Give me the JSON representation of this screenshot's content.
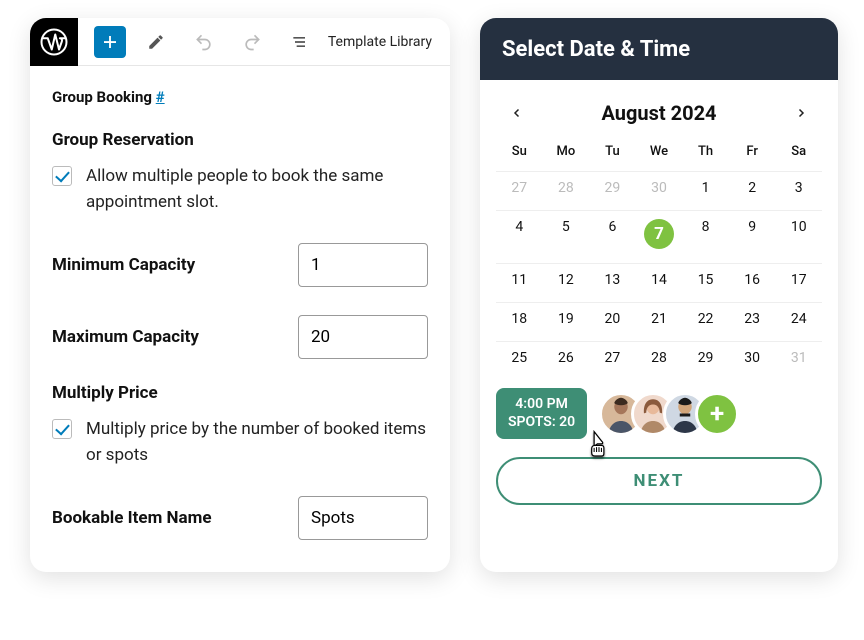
{
  "editor": {
    "toolbar": {
      "template_library": "Template Library"
    },
    "block_title": "Group Booking",
    "block_hash": "#",
    "group_reservation": {
      "title": "Group Reservation",
      "desc": "Allow multiple people to book the same appointment slot.",
      "checked": true
    },
    "min_capacity": {
      "label": "Minimum Capacity",
      "value": "1"
    },
    "max_capacity": {
      "label": "Maximum Capacity",
      "value": "20"
    },
    "multiply_price": {
      "title": "Multiply Price",
      "desc": "Multiply price by the number of booked items or spots",
      "checked": true
    },
    "bookable_item": {
      "label": "Bookable Item Name",
      "value": "Spots"
    }
  },
  "booking": {
    "header": "Select Date & Time",
    "month": "August 2024",
    "weekdays": [
      "Su",
      "Mo",
      "Tu",
      "We",
      "Th",
      "Fr",
      "Sa"
    ],
    "days": [
      {
        "d": "27",
        "other": true
      },
      {
        "d": "28",
        "other": true
      },
      {
        "d": "29",
        "other": true
      },
      {
        "d": "30",
        "other": true
      },
      {
        "d": "1"
      },
      {
        "d": "2"
      },
      {
        "d": "3"
      },
      {
        "d": "4"
      },
      {
        "d": "5"
      },
      {
        "d": "6"
      },
      {
        "d": "7",
        "selected": true
      },
      {
        "d": "8"
      },
      {
        "d": "9"
      },
      {
        "d": "10"
      },
      {
        "d": "11"
      },
      {
        "d": "12"
      },
      {
        "d": "13"
      },
      {
        "d": "14"
      },
      {
        "d": "15"
      },
      {
        "d": "16"
      },
      {
        "d": "17"
      },
      {
        "d": "18"
      },
      {
        "d": "19"
      },
      {
        "d": "20"
      },
      {
        "d": "21"
      },
      {
        "d": "22"
      },
      {
        "d": "23"
      },
      {
        "d": "24"
      },
      {
        "d": "25"
      },
      {
        "d": "26"
      },
      {
        "d": "27"
      },
      {
        "d": "28"
      },
      {
        "d": "29"
      },
      {
        "d": "30"
      },
      {
        "d": "31",
        "other": true
      }
    ],
    "slot_time": "4:00 PM",
    "slot_spots": "SPOTS: 20",
    "next": "NEXT"
  }
}
